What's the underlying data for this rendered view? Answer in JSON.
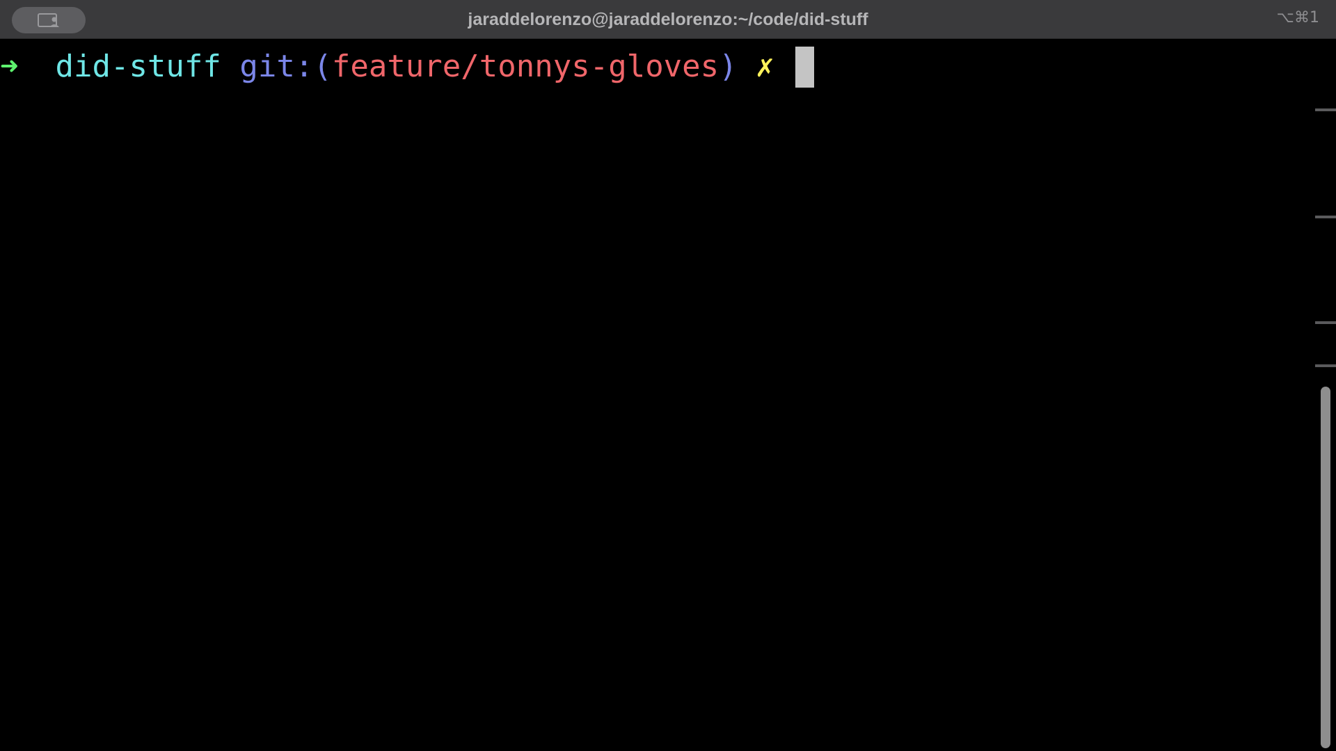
{
  "window": {
    "title": "jaraddelorenzo@jaraddelorenzo:~/code/did-stuff",
    "shortcut": "⌥⌘1"
  },
  "prompt": {
    "arrow": "➜",
    "directory": "did-stuff",
    "git_open": "git:(",
    "branch": "feature/tonnys-gloves",
    "git_close": ")",
    "dirty_marker": "✗"
  },
  "colors": {
    "arrow": "#5ef26e",
    "directory": "#6fe6e6",
    "git": "#7b86e8",
    "branch": "#f0666a",
    "dirty": "#fff25a"
  },
  "icons": {
    "profile": "person-icon"
  }
}
